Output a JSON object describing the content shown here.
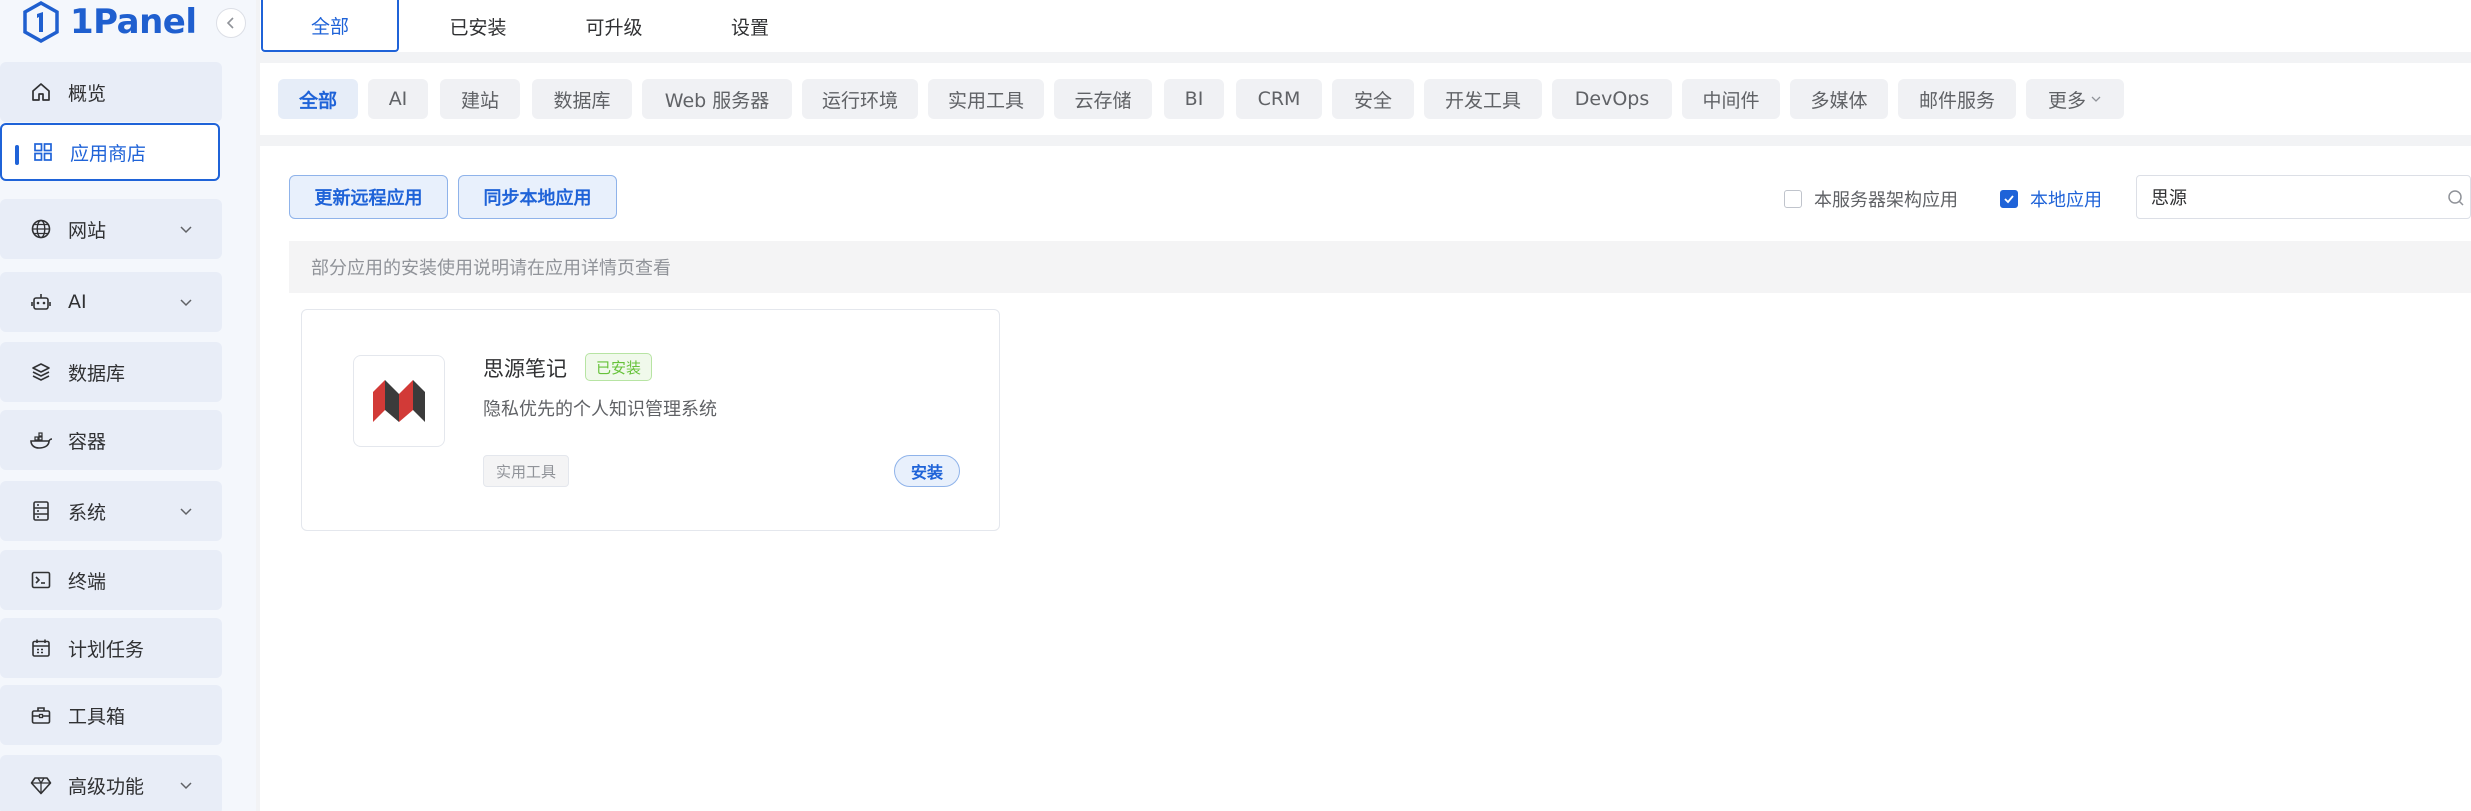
{
  "app": {
    "name": "1Panel"
  },
  "sidebar": {
    "items": [
      {
        "label": "概览",
        "icon": "home-icon",
        "expandable": false
      },
      {
        "label": "应用商店",
        "icon": "apps-grid-icon",
        "expandable": false,
        "active": true
      },
      {
        "label": "网站",
        "icon": "globe-icon",
        "expandable": true
      },
      {
        "label": "AI",
        "icon": "robot-icon",
        "expandable": true
      },
      {
        "label": "数据库",
        "icon": "layers-icon",
        "expandable": false
      },
      {
        "label": "容器",
        "icon": "docker-whale-icon",
        "expandable": false
      },
      {
        "label": "系统",
        "icon": "server-icon",
        "expandable": true
      },
      {
        "label": "终端",
        "icon": "terminal-icon",
        "expandable": false
      },
      {
        "label": "计划任务",
        "icon": "calendar-icon",
        "expandable": false
      },
      {
        "label": "工具箱",
        "icon": "toolbox-icon",
        "expandable": false
      },
      {
        "label": "高级功能",
        "icon": "diamond-icon",
        "expandable": true
      }
    ]
  },
  "tabs": [
    {
      "label": "全部",
      "active": true
    },
    {
      "label": "已安装"
    },
    {
      "label": "可升级"
    },
    {
      "label": "设置"
    }
  ],
  "categories": [
    {
      "label": "全部",
      "active": true
    },
    {
      "label": "AI"
    },
    {
      "label": "建站"
    },
    {
      "label": "数据库"
    },
    {
      "label": "Web 服务器"
    },
    {
      "label": "运行环境"
    },
    {
      "label": "实用工具"
    },
    {
      "label": "云存储"
    },
    {
      "label": "BI"
    },
    {
      "label": "CRM"
    },
    {
      "label": "安全"
    },
    {
      "label": "开发工具"
    },
    {
      "label": "DevOps"
    },
    {
      "label": "中间件"
    },
    {
      "label": "多媒体"
    },
    {
      "label": "邮件服务"
    },
    {
      "label": "更多"
    }
  ],
  "toolbar": {
    "update_remote_label": "更新远程应用",
    "sync_local_label": "同步本地应用",
    "arch_filter_label": "本服务器架构应用",
    "arch_filter_checked": false,
    "local_filter_label": "本地应用",
    "local_filter_checked": true,
    "search_value": "思源"
  },
  "notice": "部分应用的安装使用说明请在应用详情页查看",
  "apps": [
    {
      "name": "思源笔记",
      "status_tag": "已安装",
      "description": "隐私优先的个人知识管理系统",
      "category_tag": "实用工具",
      "install_label": "安装"
    }
  ],
  "colors": {
    "primary": "#1f63d8",
    "success": "#67c23a",
    "sidebar_bg": "#f4f7fc"
  }
}
